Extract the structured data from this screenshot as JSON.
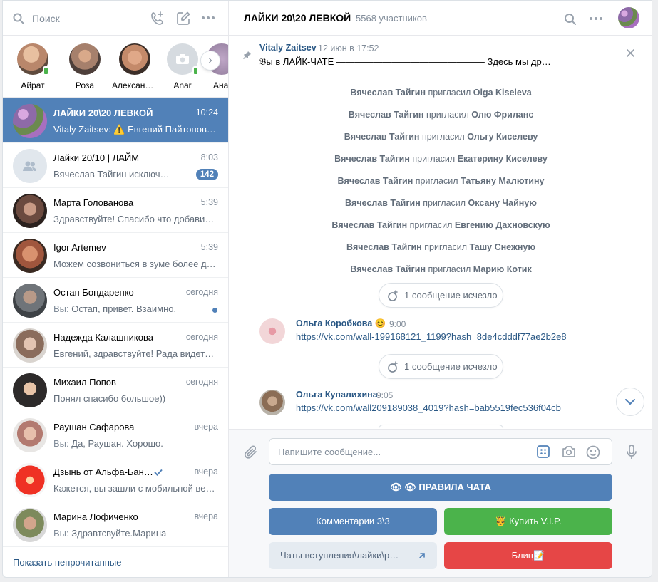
{
  "sidebar": {
    "search_placeholder": "Поиск",
    "stories": [
      {
        "name": "Айрат",
        "online": true,
        "color": "#b9876b"
      },
      {
        "name": "Роза",
        "online": false,
        "color": "#a6806c"
      },
      {
        "name": "Александ…",
        "online": false,
        "color": "#c48a6a"
      },
      {
        "name": "Anar",
        "online": true,
        "color": "#d6dbe0"
      },
      {
        "name": "Ана",
        "online": false,
        "color": "#8f7a9a"
      }
    ],
    "chats": [
      {
        "name": "ЛАЙКИ 20\\20 ЛЕВКОЙ",
        "time": "10:24",
        "preview": "Vitaly Zaitsev: ⚠️ Евгений Пайтонов, …",
        "active": true,
        "color": "#8e6aa8"
      },
      {
        "name": "Лайки 20/10 | ЛАЙМ",
        "time": "8:03",
        "preview": "Вячеслав Тайгин исключ…",
        "badge": "142",
        "color": "#e1e7ed"
      },
      {
        "name": "Марта Голованова",
        "time": "5:39",
        "preview": "Здравствуйте! Спасибо что добавили…",
        "color": "#6b4a3f"
      },
      {
        "name": "Igor Artemev",
        "time": "5:39",
        "preview": "Можем созвониться в зуме более де…",
        "color": "#a0563d"
      },
      {
        "name": "Остап Бондаренко",
        "time": "сегодня",
        "preview_prefix": "Вы:",
        "preview": "Остап, привет. Взаимно.",
        "unread_dot": true,
        "color": "#6f7479"
      },
      {
        "name": "Надежда Калашникова",
        "time": "сегодня",
        "preview": "Евгений, здравствуйте! Рада видеть …",
        "color": "#8a6c5c"
      },
      {
        "name": "Михаил Попов",
        "time": "сегодня",
        "preview": "Понял спасибо большое))",
        "color": "#2d2a2a"
      },
      {
        "name": "Раушан Сафарова",
        "time": "вчера",
        "preview_prefix": "Вы:",
        "preview": "Да, Раушан. Хорошо.",
        "color": "#b37a70"
      },
      {
        "name": "Дзынь от Альфа-Бан…",
        "time": "вчера",
        "preview": "Кажется, вы зашли с мобильной вер…",
        "verified": true,
        "color": "#ef3124"
      },
      {
        "name": "Марина Лофиченко",
        "time": "вчера",
        "preview_prefix": "Вы:",
        "preview": "Здравтсвуйте.Марина",
        "regular": true,
        "color": "#7d8a5c"
      }
    ],
    "show_unread": "Показать непрочитанные"
  },
  "conversation": {
    "title": "ЛАЙКИ 20\\20 ЛЕВКОЙ",
    "members": "5568 участников",
    "pinned": {
      "author": "Vitaly Zaitsev",
      "date": "12 июн в 17:52",
      "text": "𝔅ы в ЛАЙК-ЧАТЕ ———————————————— Здесь мы др…"
    },
    "system_messages": [
      {
        "actor": "Вячеслав Тайгин",
        "action": "пригласил",
        "target": "Olga Kiseleva"
      },
      {
        "actor": "Вячеслав Тайгин",
        "action": "пригласил",
        "target": "Олю Фриланс"
      },
      {
        "actor": "Вячеслав Тайгин",
        "action": "пригласил",
        "target": "Ольгу Киселеву"
      },
      {
        "actor": "Вячеслав Тайгин",
        "action": "пригласил",
        "target": "Екатерину Киселеву"
      },
      {
        "actor": "Вячеслав Тайгин",
        "action": "пригласил",
        "target": "Татьяну Малютину"
      },
      {
        "actor": "Вячеслав Тайгин",
        "action": "пригласил",
        "target": "Оксану Чайную"
      },
      {
        "actor": "Вячеслав Тайгин",
        "action": "пригласил",
        "target": "Евгению Дахновскую"
      },
      {
        "actor": "Вячеслав Тайгин",
        "action": "пригласил",
        "target": "Ташу Снежную"
      },
      {
        "actor": "Вячеслав Тайгин",
        "action": "пригласил",
        "target": "Марию Котик"
      }
    ],
    "disappeared_label": "1 сообщение исчезло",
    "messages": [
      {
        "author": "Ольга Коробкова 😊",
        "time": "9:00",
        "text": "https://vk.com/wall-199168121_1199?hash=8de4cdddf77ae2b2e8",
        "color": "#f2d6d8"
      },
      {
        "author": "Ольга Купалихина",
        "time": "9:05",
        "text": "https://vk.com/wall209189038_4019?hash=bab5519fec536f04cb",
        "color": "#8b6d55"
      }
    ],
    "composer": {
      "placeholder": "Напишите сообщение..."
    },
    "keyboard": {
      "rules": "👁 👁 ПРАВИЛА ЧАТА",
      "comments": "Комментарии 3\\3",
      "buy_vip": "🤴 Купить V.I.P.",
      "join_chats": "Чаты вступления\\лайки\\р…",
      "blitz": "Блиц📝"
    }
  }
}
